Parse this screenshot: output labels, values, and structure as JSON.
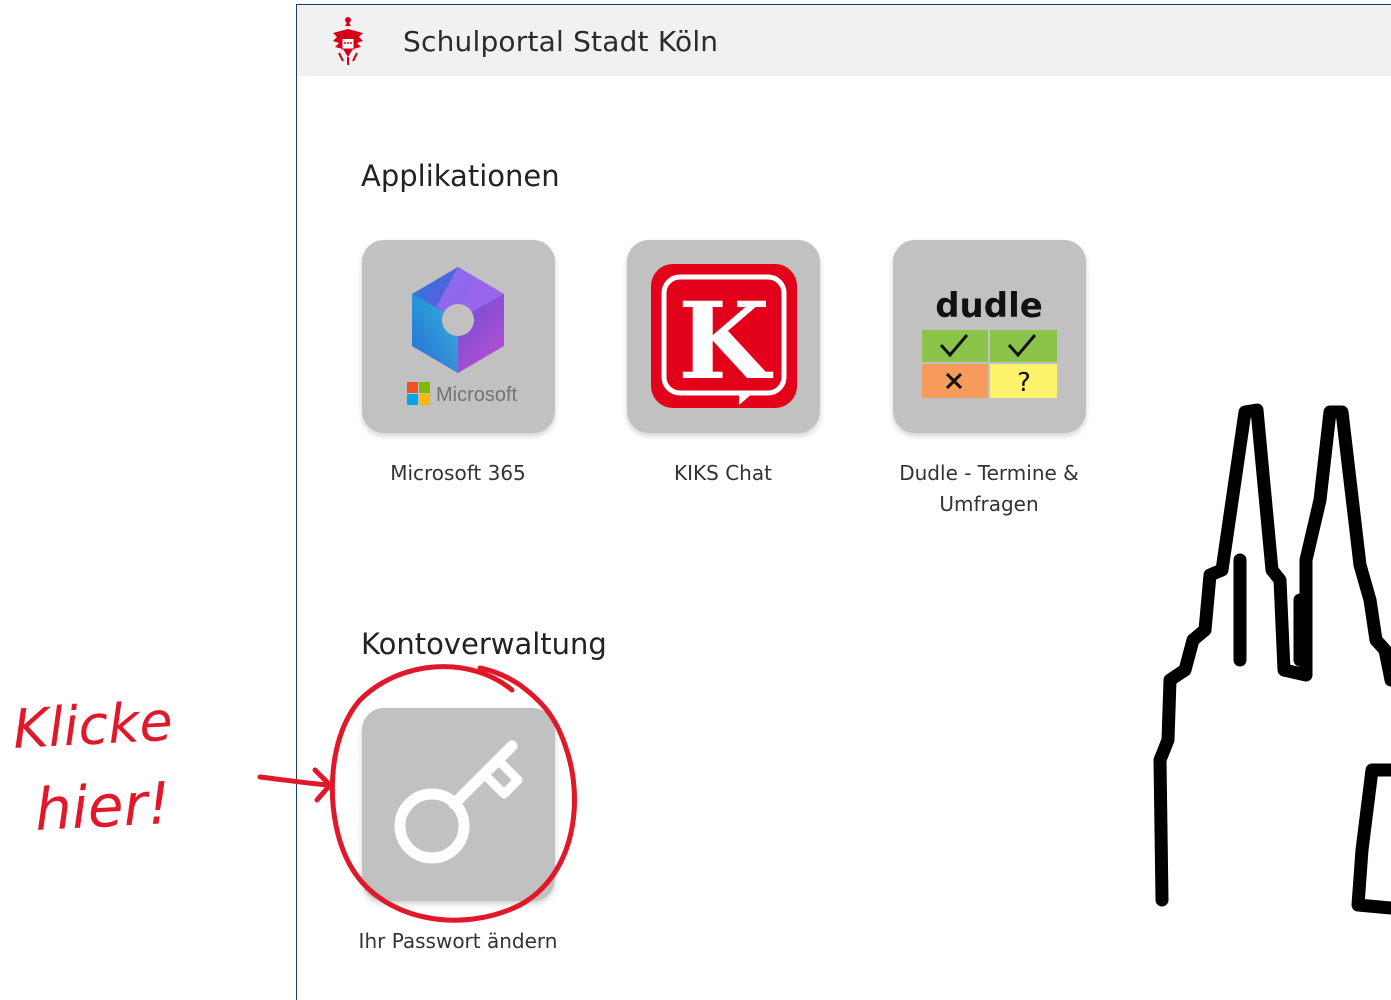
{
  "header": {
    "title": "Schulportal Stadt Köln"
  },
  "sections": {
    "apps_title": "Applikationen",
    "account_title": "Kontoverwaltung"
  },
  "apps": [
    {
      "label": "Microsoft 365",
      "icon": "microsoft-365-icon",
      "brand_text": "Microsoft"
    },
    {
      "label": "KIKS Chat",
      "icon": "kiks-chat-icon"
    },
    {
      "label": "Dudle - Termine & Umfragen",
      "icon": "dudle-icon",
      "brand_text": "dudle"
    }
  ],
  "account": [
    {
      "label": "Ihr Passwort ändern",
      "icon": "key-icon"
    }
  ],
  "annotation": {
    "text_line1": "Klicke",
    "text_line2": "hier!"
  },
  "colors": {
    "frame": "#1f3a6e",
    "tile": "#c1c1c1",
    "annotation": "#e0182a",
    "kiks_red": "#e3001b"
  }
}
